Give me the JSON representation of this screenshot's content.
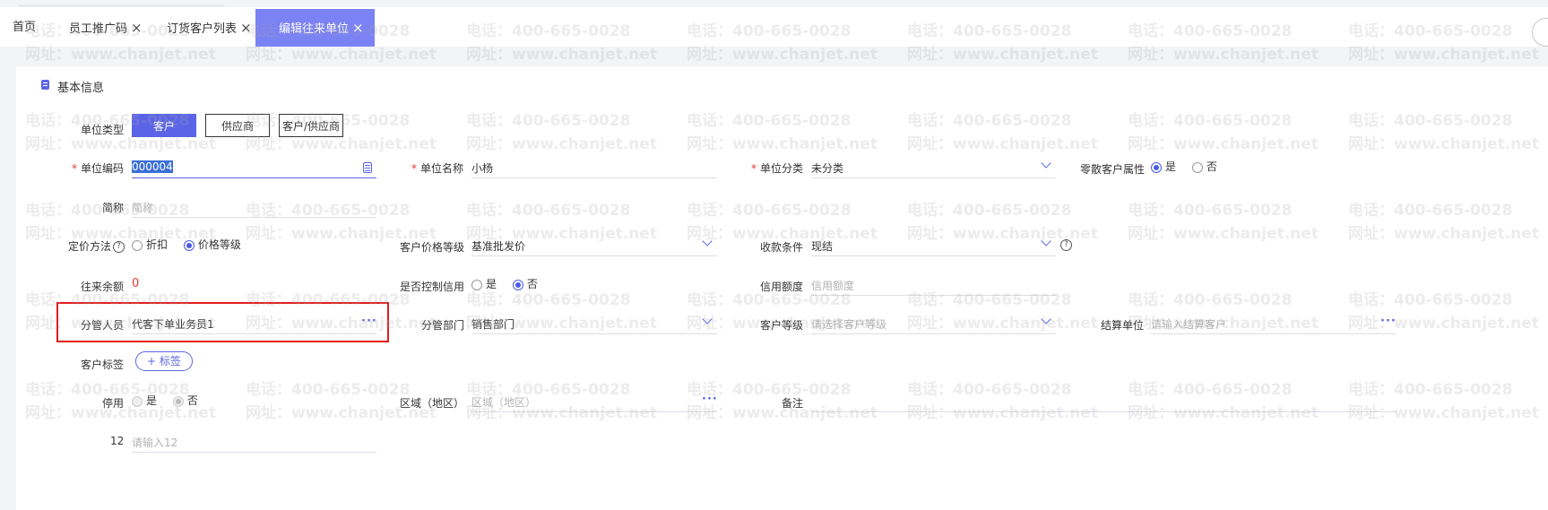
{
  "tabs": [
    {
      "label": "首页",
      "closable": false
    },
    {
      "label": "员工推广码",
      "closable": true
    },
    {
      "label": "订货客户列表",
      "closable": true
    },
    {
      "label": "编辑往来单位",
      "closable": true,
      "active": true
    }
  ],
  "close_glyph": "×",
  "section": {
    "title": "基本信息",
    "icon": "document-icon"
  },
  "unit_type": {
    "label": "单位类型",
    "options": [
      "客户",
      "供应商",
      "客户/供应商"
    ],
    "selected": "客户"
  },
  "fields": {
    "unit_code": {
      "label": "单位编码",
      "value": "000004",
      "required": true
    },
    "unit_name": {
      "label": "单位名称",
      "value": "小杨",
      "required": true
    },
    "unit_category": {
      "label": "单位分类",
      "value": "未分类",
      "required": true
    },
    "retail_attr": {
      "label": "零散客户属性",
      "options": [
        "是",
        "否"
      ],
      "selected": "是"
    },
    "short_name": {
      "label": "简称",
      "placeholder": "简称"
    },
    "pricing_method": {
      "label": "定价方法",
      "options": [
        "折扣",
        "价格等级"
      ],
      "selected": "价格等级"
    },
    "price_level": {
      "label": "客户价格等级",
      "value": "基准批发价"
    },
    "payment_terms": {
      "label": "收款条件",
      "value": "现结"
    },
    "balance": {
      "label": "往来余额",
      "value": "0"
    },
    "credit_control": {
      "label": "是否控制信用",
      "options": [
        "是",
        "否"
      ],
      "selected": "否"
    },
    "credit_limit": {
      "label": "信用额度",
      "placeholder": "信用额度"
    },
    "salesperson": {
      "label": "分管人员",
      "value": "代客下单业务员1"
    },
    "department": {
      "label": "分管部门",
      "value": "销售部门"
    },
    "customer_level": {
      "label": "客户等级",
      "placeholder": "请选择客户等级"
    },
    "settlement_unit": {
      "label": "结算单位",
      "placeholder": "请输入结算客户"
    },
    "customer_tag": {
      "label": "客户标签",
      "button": "+ 标签"
    },
    "disabled": {
      "label": "停用",
      "options": [
        "是",
        "否"
      ],
      "selected": "否"
    },
    "region": {
      "label": "区域（地区）",
      "placeholder": "区域（地区）"
    },
    "remark": {
      "label": "备注"
    },
    "field12": {
      "label": "12",
      "placeholder": "请输入12"
    }
  },
  "ellipsis": "···",
  "question": "?",
  "watermark": {
    "phone": "电话：400-665-0028",
    "site": "网址：www.chanjet.net"
  },
  "colors": {
    "accent": "#5b64e6",
    "active_tab": "#7a82f4",
    "required": "#e53935",
    "balance": "#e53935",
    "highlight": "#e11d1d"
  }
}
